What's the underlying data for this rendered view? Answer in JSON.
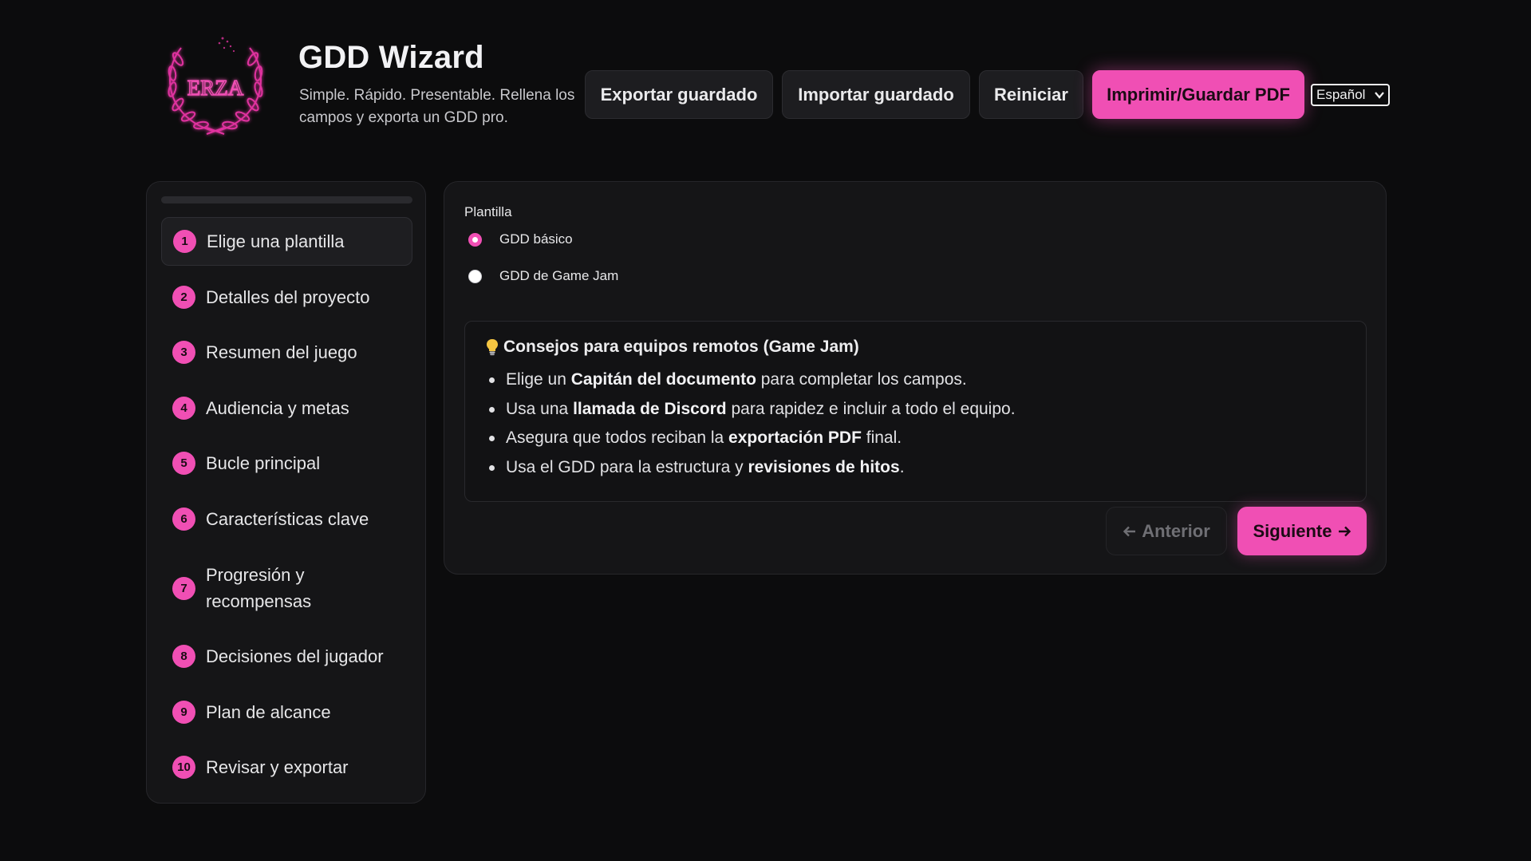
{
  "header": {
    "logo_text": "ERZA",
    "title": "GDD Wizard",
    "subtitle": "Simple. Rápido. Presentable. Rellena los campos y exporta un GDD pro."
  },
  "toolbar": {
    "export_label": "Exportar guardado",
    "import_label": "Importar guardado",
    "reset_label": "Reiniciar",
    "print_label": "Imprimir/Guardar PDF",
    "language_selected": "Español"
  },
  "sidebar": {
    "progress": 0,
    "steps": [
      {
        "num": "1",
        "label": "Elige una plantilla",
        "active": true
      },
      {
        "num": "2",
        "label": "Detalles del proyecto"
      },
      {
        "num": "3",
        "label": "Resumen del juego"
      },
      {
        "num": "4",
        "label": "Audiencia y metas"
      },
      {
        "num": "5",
        "label": "Bucle principal"
      },
      {
        "num": "6",
        "label": "Características clave"
      },
      {
        "num": "7",
        "label": "Progresión y recompensas"
      },
      {
        "num": "8",
        "label": "Decisiones del jugador"
      },
      {
        "num": "9",
        "label": "Plan de alcance"
      },
      {
        "num": "10",
        "label": "Revisar y exportar"
      }
    ]
  },
  "main": {
    "template_label": "Plantilla",
    "options": [
      {
        "label": "GDD básico",
        "checked": true
      },
      {
        "label": "GDD de Game Jam",
        "checked": false
      }
    ],
    "tips": {
      "title": "Consejos para equipos remotos (Game Jam)",
      "items": [
        {
          "pre": "Elige un ",
          "bold": "Capitán del documento",
          "post": " para completar los campos."
        },
        {
          "pre": "Usa una ",
          "bold": "llamada de Discord",
          "post": " para rapidez e incluir a todo el equipo."
        },
        {
          "pre": "Asegura que todos reciban la ",
          "bold": "exportación PDF",
          "post": " final."
        },
        {
          "pre": "Usa el GDD para la estructura y ",
          "bold": "revisiones de hitos",
          "post": "."
        }
      ]
    },
    "prev_label": "Anterior",
    "next_label": "Siguiente"
  },
  "colors": {
    "accent": "#f04fb4",
    "background": "#0c0c0d",
    "panel": "#151517"
  },
  "icons": {
    "logo": "laurel-wreath-logo",
    "tips": "lightbulb-icon",
    "prev": "arrow-left-icon",
    "next": "arrow-right-icon",
    "select": "chevron-down-icon"
  }
}
